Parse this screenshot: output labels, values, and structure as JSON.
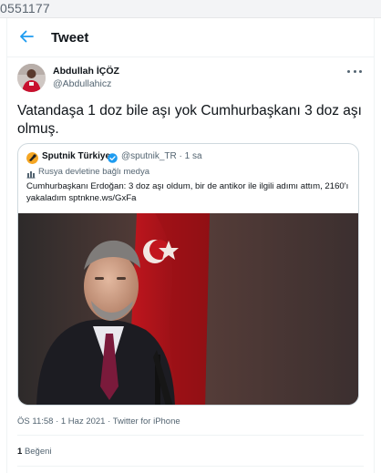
{
  "url_fragment": "0551177",
  "header": {
    "title": "Tweet",
    "back_icon": "arrow-left-icon",
    "accent": "#1d9bf0"
  },
  "author": {
    "name": "Abdullah İÇÖZ",
    "handle": "@Abdullahicz"
  },
  "tweet": {
    "text": "Vatandaşa 1 doz bile aşı yok Cumhurbaşkanı 3 doz aşı olmuş."
  },
  "quote": {
    "name": "Sputnik Türkiye",
    "verified": true,
    "verified_color": "#1d9bf0",
    "handle": "@sputnik_TR",
    "separator": "·",
    "time": "1 sa",
    "label": "Rusya devletine bağlı medya",
    "label_icon": "state-media-icon",
    "text": "Cumhurbaşkanı Erdoğan: 3 doz aşı oldum, bir de antikor ile ilgili adımı attım, 2160'ı yakaladım sptnkne.ws/GxFa"
  },
  "meta": {
    "text": "ÖS 11:58 · 1 Haz 2021 · Twitter for iPhone"
  },
  "likes": {
    "count": "1",
    "label": "Beğeni"
  }
}
